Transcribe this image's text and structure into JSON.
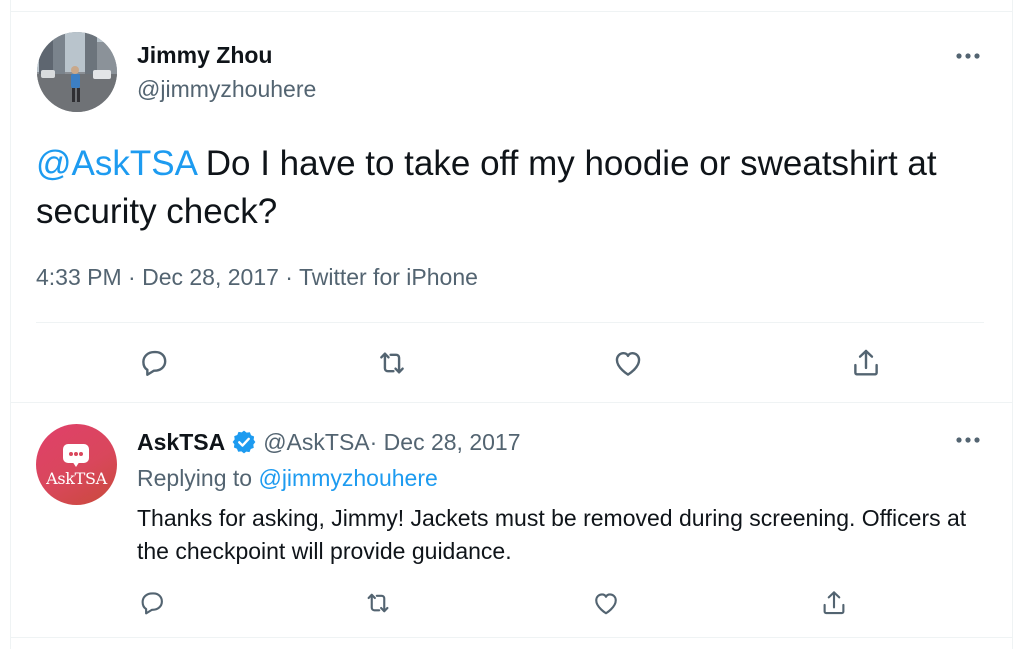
{
  "main_tweet": {
    "author_name": "Jimmy Zhou",
    "author_handle": "@jimmyzhouhere",
    "mention": "@AskTSA",
    "text": " Do I have to take off my hoodie or sweatshirt at security check?",
    "meta": "4:33 PM · Dec 28, 2017 · Twitter for iPhone",
    "actions": [
      "reply-icon",
      "retweet-icon",
      "like-icon",
      "share-icon"
    ]
  },
  "reply_tweet": {
    "author_name": "AskTSA",
    "verified": true,
    "author_handle": "@AskTSA",
    "date": " · Dec 28, 2017",
    "replying_prefix": "Replying to ",
    "replying_to": "@jimmyzhouhere",
    "text": "Thanks for asking, Jimmy! Jackets must be removed during screening. Officers at the checkpoint will provide guidance.",
    "avatar_logo_text": "AskTSA",
    "actions": [
      "reply-icon",
      "retweet-icon",
      "like-icon",
      "share-icon"
    ]
  },
  "colors": {
    "link": "#1d9bf0",
    "secondary_text": "#536471",
    "primary_text": "#0f1419",
    "verified_badge": "#1d9bf0",
    "tsa_avatar": "#d9475c"
  }
}
